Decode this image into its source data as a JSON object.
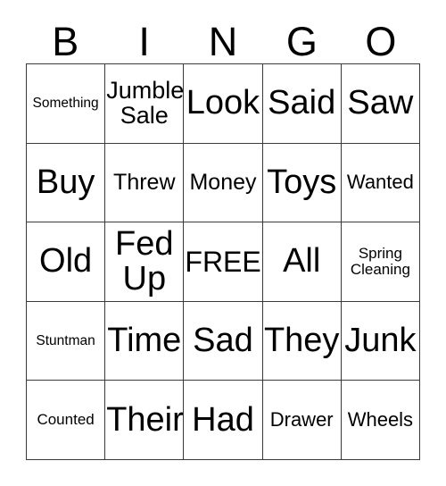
{
  "card": {
    "title": "BINGO",
    "free_space_label": "FREE",
    "border_color": "#3a3a3a",
    "text_color": "#000000",
    "background_color": "#ffffff"
  },
  "header": {
    "letters": [
      "B",
      "I",
      "N",
      "G",
      "O"
    ]
  },
  "grid": {
    "columns": 5,
    "rows": 5,
    "cells": [
      [
        {
          "text": "Something",
          "size": "xs"
        },
        {
          "text": "Jumble\nSale",
          "size": "l"
        },
        {
          "text": "Look",
          "size": "xxl"
        },
        {
          "text": "Said",
          "size": "xxl"
        },
        {
          "text": "Saw",
          "size": "xxl"
        }
      ],
      [
        {
          "text": "Buy",
          "size": "xxl"
        },
        {
          "text": "Threw",
          "size": "ml"
        },
        {
          "text": "Money",
          "size": "ml"
        },
        {
          "text": "Toys",
          "size": "xxl"
        },
        {
          "text": "Wanted",
          "size": "m"
        }
      ],
      [
        {
          "text": "Old",
          "size": "xxl"
        },
        {
          "text": "Fed\nUp",
          "size": "xxl"
        },
        {
          "text": "FREE",
          "size": "xl"
        },
        {
          "text": "All",
          "size": "xxl"
        },
        {
          "text": "Spring\nCleaning",
          "size": "s"
        }
      ],
      [
        {
          "text": "Stuntman",
          "size": "xs"
        },
        {
          "text": "Time",
          "size": "xxl"
        },
        {
          "text": "Sad",
          "size": "xxl"
        },
        {
          "text": "They",
          "size": "xxl"
        },
        {
          "text": "Junk",
          "size": "xxl"
        }
      ],
      [
        {
          "text": "Counted",
          "size": "s"
        },
        {
          "text": "Their",
          "size": "xxl"
        },
        {
          "text": "Had",
          "size": "xxl"
        },
        {
          "text": "Drawer",
          "size": "m"
        },
        {
          "text": "Wheels",
          "size": "m"
        }
      ]
    ]
  }
}
